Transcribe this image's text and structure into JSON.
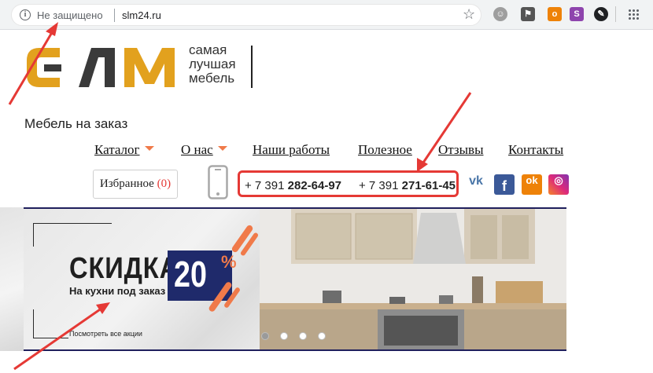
{
  "browser": {
    "security_label": "Не защищено",
    "url": "slm24.ru",
    "info_icon": "info-icon",
    "star_icon": "star-icon",
    "extensions": [
      "ghost-extension-icon",
      "flag-extension-icon",
      "odnoklassniki-extension-icon",
      "s-extension-icon",
      "tool-extension-icon",
      "apps-grid-icon"
    ]
  },
  "logo": {
    "mark_text": "СЛМ",
    "slogan_lines": [
      "самая",
      "лучшая",
      "мебель"
    ],
    "colors": {
      "accent": "#e2a11e",
      "dark": "#3a3a3a"
    }
  },
  "tagline": "Мебель на заказ",
  "nav": [
    {
      "label": "Каталог",
      "has_dropdown": true
    },
    {
      "label": "О нас",
      "has_dropdown": true
    },
    {
      "label": "Наши работы",
      "has_dropdown": false
    },
    {
      "label": "Полезное",
      "has_dropdown": false
    },
    {
      "label": "Отзывы",
      "has_dropdown": false
    },
    {
      "label": "Контакты",
      "has_dropdown": false
    }
  ],
  "favorites": {
    "label": "Избранное",
    "count": "(0)"
  },
  "phones": [
    {
      "code": "+ 7 391 ",
      "number": "282-64-97"
    },
    {
      "code": "+ 7 391 ",
      "number": "271-61-45"
    }
  ],
  "social": [
    "vk-icon",
    "facebook-icon",
    "odnoklassniki-icon",
    "instagram-icon"
  ],
  "banner": {
    "title": "СКИДКА",
    "percent": "20",
    "percent_sign": "%",
    "subtitle": "На кухни под заказ",
    "link": "Посмотреть все акции",
    "slides": 4,
    "active_slide": 1
  },
  "annotation_color": "#e53935"
}
